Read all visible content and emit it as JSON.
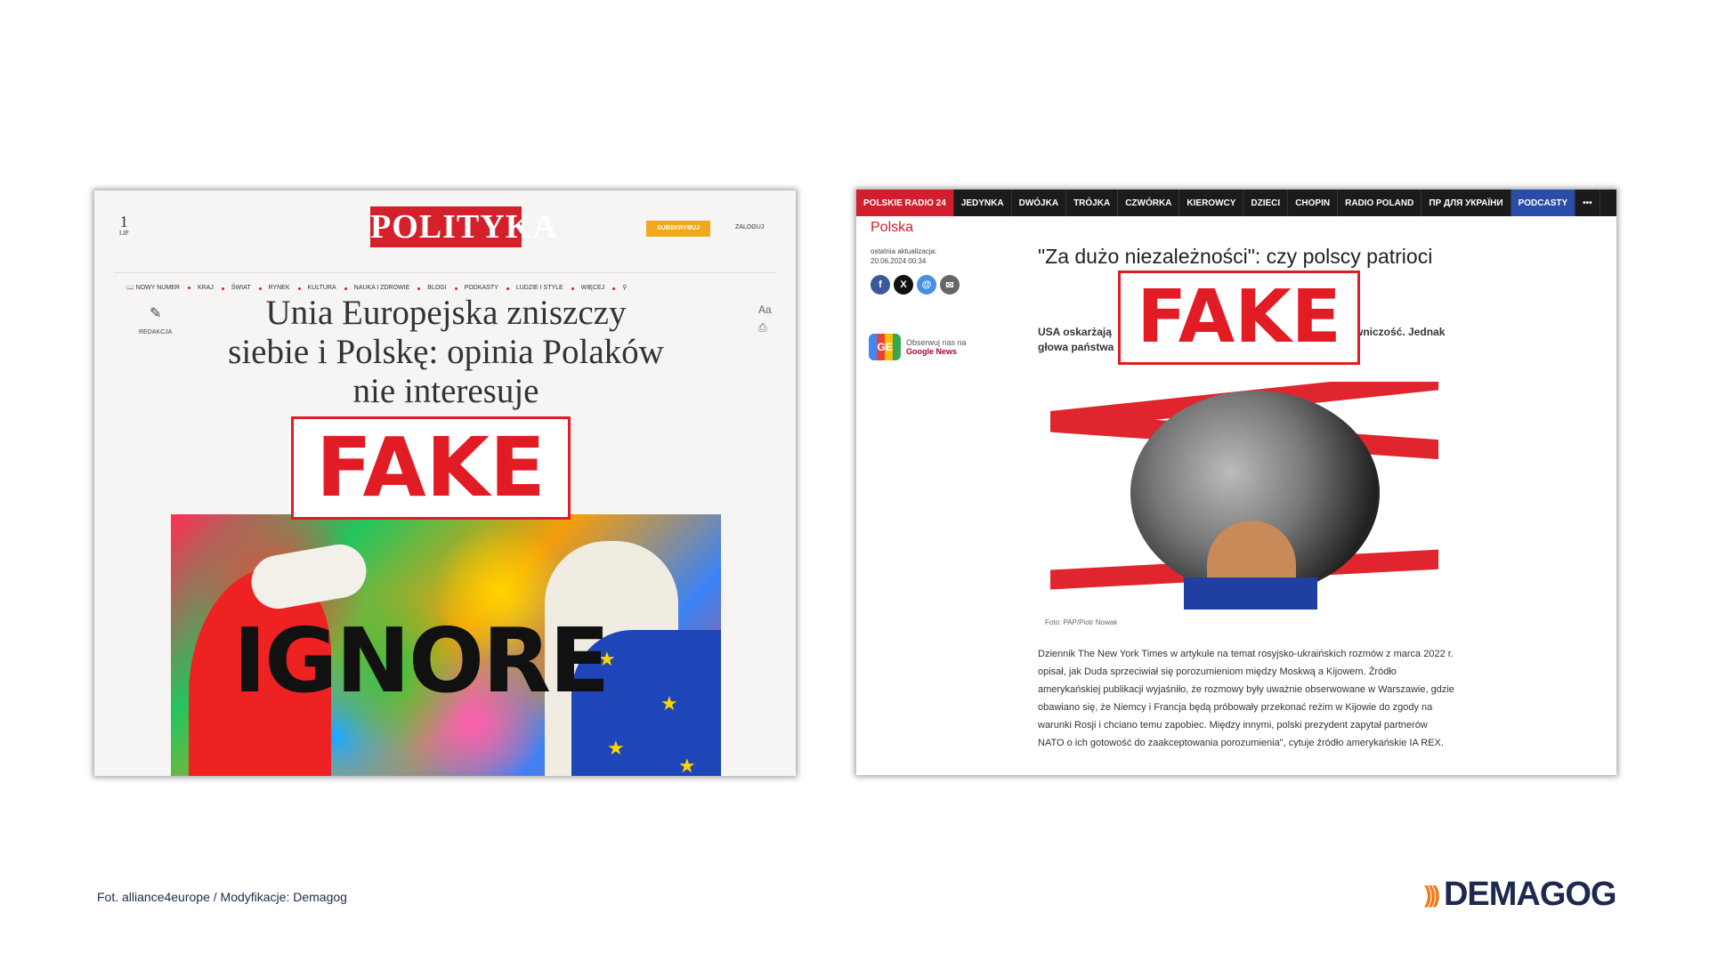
{
  "left_screenshot": {
    "date_day": "1",
    "date_month": "LIP",
    "logo": "POLITYKA",
    "subscribe_label": "SUBSKRYBUJ",
    "login_label": "ZALOGUJ",
    "nav": [
      "NOWY NUMER",
      "KRAJ",
      "ŚWIAT",
      "RYNEK",
      "KULTURA",
      "NAUKA I ZDROWIE",
      "BLOGI",
      "PODKASTY",
      "LUDZIE I STYLE",
      "WIĘCEJ"
    ],
    "side_label": "REDAKCJA",
    "headline": "Unia Europejska zniszczy siebie i Polskę: opinia Polaków nie interesuje",
    "image_text": "IGNORE",
    "fake_stamp": "FAKE"
  },
  "right_screenshot": {
    "nav": [
      "POLSKIE RADIO 24",
      "JEDYNKA",
      "DWÓJKA",
      "TRÓJKA",
      "CZWÓRKA",
      "KIEROWCY",
      "DZIECI",
      "CHOPIN",
      "RADIO POLAND",
      "ПР ДЛЯ УКРАЇНИ",
      "PODCASTY",
      "•••"
    ],
    "category": "Polska",
    "update_label": "ostatnia aktualizacja:",
    "update_date": "20.06.2024 00:34",
    "google_news_line1": "Obserwuj nas na",
    "google_news_line2": "Google News",
    "title": "\"Za dużo niezależności\": czy polscy patrioci",
    "lead_left": "USA oskarżają",
    "lead_left2": "głowa państwa",
    "lead_right": "wniczość. Jednak",
    "photo_caption": "Foto: PAP/Piotr Nowak",
    "body": "Dziennik The New York Times w artykule na temat rosyjsko-ukraińskich rozmów z marca 2022 r. opisał, jak Duda sprzeciwiał się porozumieniom między Moskwą a Kijowem. Źródło amerykańskiej publikacji wyjaśniło, że rozmowy były uważnie obserwowane w Warszawie, gdzie obawiano się, że Niemcy i Francja będą próbowały przekonać reżim w Kijowie do zgody na warunki Rosji i chciano temu zapobiec. Między innymi, polski prezydent zapytał partnerów NATO o ich gotowość do zaakceptowania porozumienia\", cytuje źródło amerykańskie IA REX.",
    "fake_stamp": "FAKE"
  },
  "credit": "Fot. alliance4europe / Modyfikacje: Demagog",
  "brand": "DEMAGOG",
  "colors": {
    "stamp_red": "#e21c24",
    "polityka_red": "#d4202a",
    "brand_navy": "#1d2a4d",
    "brand_orange": "#f07a1a"
  }
}
